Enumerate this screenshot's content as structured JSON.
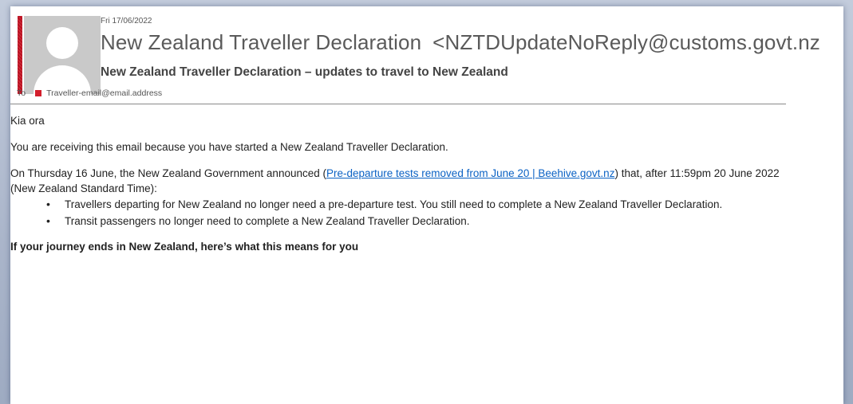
{
  "email": {
    "date": "Fri 17/06/2022",
    "sender_name": "New Zealand Traveller Declaration",
    "sender_email": "<NZTDUpdateNoReply@customs.govt.nz",
    "subject": "New Zealand Traveller Declaration – updates to travel to New Zealand",
    "to_label": "To",
    "recipient": "Traveller-email@email.address"
  },
  "body": {
    "greeting": "Kia ora",
    "intro": "You are receiving this email because you have started a New Zealand Traveller Declaration.",
    "announce_before": "On Thursday 16 June, the New Zealand Government announced (",
    "announce_link": "Pre-departure tests removed from June 20 | Beehive.govt.nz",
    "announce_after": ") that, after 11:59pm 20 June 2022 (New Zealand Standard Time):",
    "bullets": [
      "Travellers departing for New Zealand no longer need a pre-departure test. You still need to complete a New Zealand Traveller Declaration.",
      "Transit passengers no longer need to complete a New Zealand Traveller Declaration."
    ],
    "closing": "If your journey ends in New Zealand, here’s what this means for you"
  },
  "colors": {
    "link": "#0b62c4",
    "flag_bar": "#c8102e",
    "recipient_icon": "#d31f2c",
    "background": "#a9b4c9"
  }
}
